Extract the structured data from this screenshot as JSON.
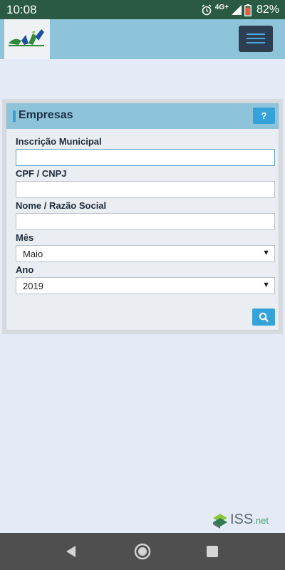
{
  "status_bar": {
    "time": "10:08",
    "network": "4G+",
    "battery": "82%"
  },
  "app_bar": {
    "logo": "prefeitura-logo-icon",
    "menu_icon": "hamburger-menu-icon"
  },
  "panel": {
    "title": "Empresas",
    "help_label": "?",
    "fields": {
      "inscricao_label": "Inscrição Municipal",
      "inscricao_value": "",
      "cpf_label": "CPF / CNPJ",
      "cpf_value": "",
      "nome_label": "Nome / Razão Social",
      "nome_value": "",
      "mes_label": "Mês",
      "mes_value": "Maio",
      "ano_label": "Ano",
      "ano_value": "2019"
    },
    "search_icon": "search-icon"
  },
  "footer_brand": {
    "text": "ISS",
    "suffix": ".net"
  },
  "colors": {
    "status_bar": "#2a5a43",
    "header": "#8dc4da",
    "accent": "#35a3d9",
    "background": "#e4ebf7"
  }
}
